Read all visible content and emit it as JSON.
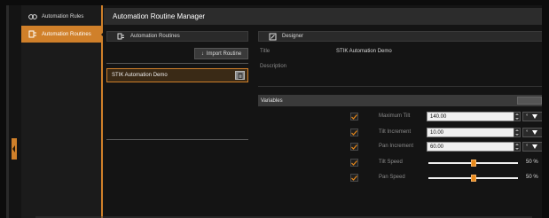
{
  "nav": {
    "items": [
      {
        "label": "Automation Rules",
        "icon": "link-icon"
      },
      {
        "label": "Automation Routines",
        "icon": "routine-icon",
        "active": true
      }
    ]
  },
  "main": {
    "title": "Automation Routine Manager"
  },
  "routines": {
    "header": "Automation Routines",
    "import_label": "Import Routine",
    "items": [
      {
        "name": "STIK Automation Demo",
        "selected": true
      }
    ]
  },
  "designer": {
    "header": "Designer",
    "title_label": "Title",
    "title_value": "STIK Automation Demo",
    "description_label": "Description",
    "description_value": ""
  },
  "variables": {
    "header": "Variables",
    "rows": [
      {
        "label": "Maximum Tilt",
        "checked": true,
        "value": "140.00",
        "unit": "°"
      },
      {
        "label": "Tilt Increment",
        "checked": true,
        "value": "10.00",
        "unit": "°"
      },
      {
        "label": "Pan Increment",
        "checked": true,
        "value": "60.00",
        "unit": "°"
      },
      {
        "label": "Tilt Speed",
        "checked": true,
        "percent": "50 %",
        "level": 0.5
      },
      {
        "label": "Pan Speed",
        "checked": true,
        "percent": "50 %",
        "level": 0.5
      }
    ]
  },
  "colors": {
    "accent": "#d0802a",
    "background": "#141414",
    "panel": "#2c2c2c"
  }
}
